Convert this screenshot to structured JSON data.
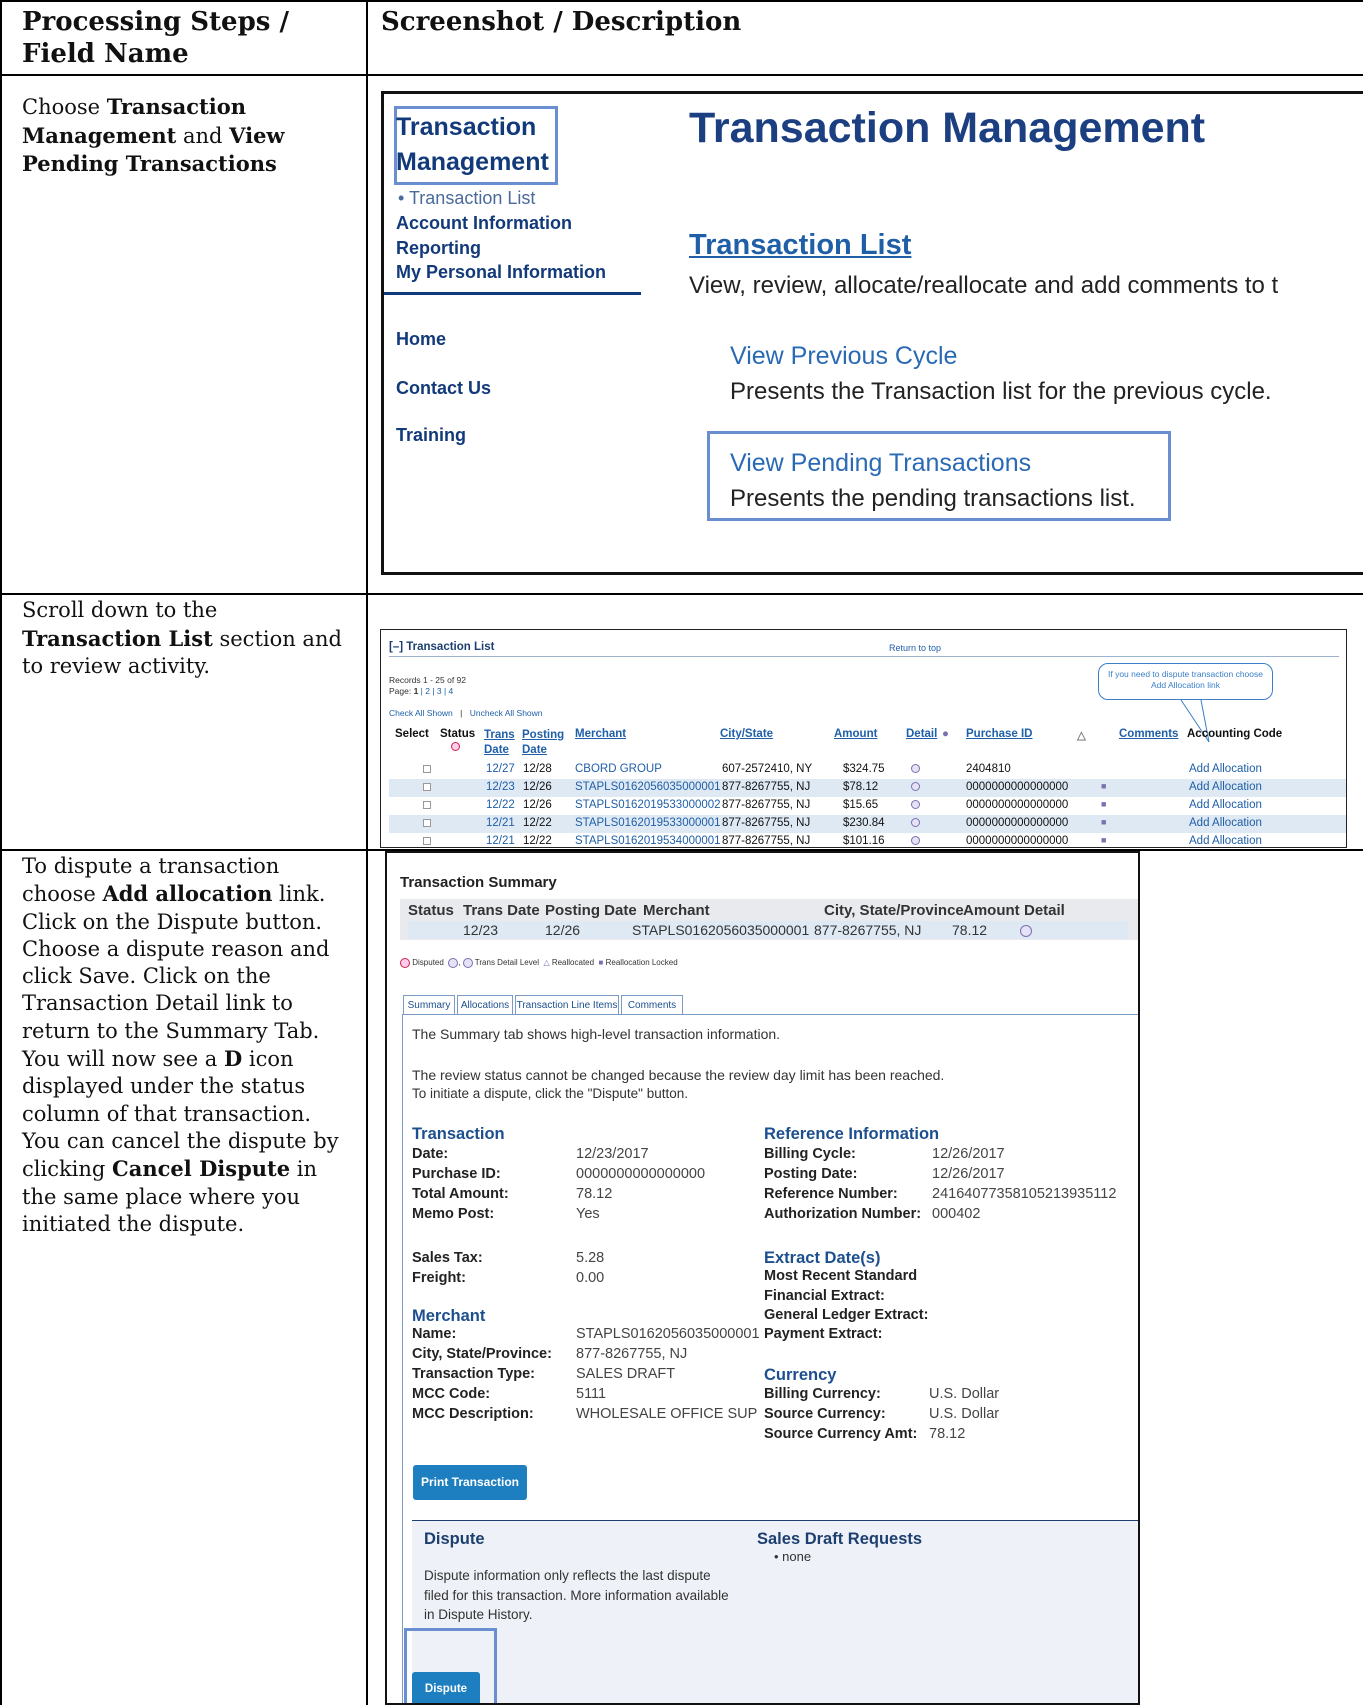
{
  "headers": {
    "col1": "Processing Steps / Field Name",
    "col2": "Screenshot / Description"
  },
  "steps": {
    "s1_a": "Choose ",
    "s1_b": "Transaction Management",
    "s1_c": " and ",
    "s1_d": "View Pending Transactions",
    "s2_a": "Scroll down to the ",
    "s2_b": "Transaction List",
    "s2_c": " section and to review activity.",
    "s3_a": "To dispute a transaction choose ",
    "s3_b": "Add allocation",
    "s3_c": " link. Click on the Dispute button. Choose a dispute reason and click Save. Click on the Transaction Detail link to return to the Summary Tab. You will now see a ",
    "s3_d": "D",
    "s3_e": " icon displayed under the status column of that transaction. You can cancel the dispute by clicking ",
    "s3_f": "Cancel Dispute",
    "s3_g": " in the same place where you initiated the dispute."
  },
  "shot1": {
    "nav_tm_1": "Transaction",
    "nav_tm_2": "Management",
    "nav_sub": "• Transaction List",
    "nav_account": "Account Information",
    "nav_reporting": "Reporting",
    "nav_personal": "My Personal Information",
    "nav_home": "Home",
    "nav_contact": "Contact Us",
    "nav_training": "Training",
    "title": "Transaction Management",
    "list_link": "Transaction List",
    "list_desc": "View, review, allocate/reallocate and add comments to t",
    "prev_link": "View Previous Cycle",
    "prev_desc": "Presents the Transaction list for the previous cycle.",
    "pending_link": "View Pending Transactions",
    "pending_desc": "Presents the pending transactions list."
  },
  "shot2": {
    "section_title": "[–] Transaction List",
    "return_top": "Return to top",
    "records": "Records 1 - 25 of 92",
    "page_label": "Page: ",
    "page_current": "1",
    "page_others": " | 2 | 3 | 4",
    "check_all": "Check All Shown",
    "sep": "|",
    "uncheck_all": "Uncheck All Shown",
    "callout": "If you need to dispute transaction choose Add Allocation link",
    "columns": {
      "select": "Select",
      "status": "Status",
      "trans_date_1": "Trans",
      "trans_date_2": "Date",
      "posting_date_1": "Posting",
      "posting_date_2": "Date",
      "merchant": "Merchant",
      "city_state": "City/State",
      "amount": "Amount",
      "detail": "Detail",
      "purchase_id": "Purchase ID",
      "comments": "Comments",
      "accounting_code": "Accounting Code"
    },
    "rows": [
      {
        "trans": "12/27",
        "post": "12/28",
        "merchant": "CBORD GROUP",
        "city": "607-2572410, NY",
        "amount": "$324.75",
        "pid": "2404810",
        "action": "Add Allocation"
      },
      {
        "trans": "12/23",
        "post": "12/26",
        "merchant": "STAPLS0162056035000001",
        "city": "877-8267755, NJ",
        "amount": "$78.12",
        "pid": "0000000000000000",
        "action": "Add Allocation"
      },
      {
        "trans": "12/22",
        "post": "12/26",
        "merchant": "STAPLS0162019533000002",
        "city": "877-8267755, NJ",
        "amount": "$15.65",
        "pid": "0000000000000000",
        "action": "Add Allocation"
      },
      {
        "trans": "12/21",
        "post": "12/22",
        "merchant": "STAPLS0162019533000001",
        "city": "877-8267755, NJ",
        "amount": "$230.84",
        "pid": "0000000000000000",
        "action": "Add Allocation"
      },
      {
        "trans": "12/21",
        "post": "12/22",
        "merchant": "STAPLS0162019534000001",
        "city": "877-8267755, NJ",
        "amount": "$101.16",
        "pid": "0000000000000000",
        "action": "Add Allocation"
      }
    ]
  },
  "shot3": {
    "summary_title": "Transaction Summary",
    "cols": {
      "status": "Status",
      "trans_date": "Trans Date",
      "posting_date": "Posting Date",
      "merchant": "Merchant",
      "city": "City, State/Province",
      "amount": "Amount",
      "detail": "Detail"
    },
    "row": {
      "trans_date": "12/23",
      "posting_date": "12/26",
      "merchant": "STAPLS0162056035000001",
      "city": "877-8267755, NJ",
      "amount": "78.12"
    },
    "legend": {
      "disputed": "Disputed",
      "trans_detail": "Trans Detail Level",
      "reallocated": "Reallocated",
      "locked": "Reallocation Locked"
    },
    "tabs": [
      "Summary",
      "Allocations",
      "Transaction Line Items",
      "Comments"
    ],
    "intro": "The Summary tab shows high-level transaction information.",
    "note1": "The review status cannot be changed because the review day limit has been reached.",
    "note2": "To initiate a dispute, click the \"Dispute\" button.",
    "transaction": {
      "heading": "Transaction",
      "date_l": "Date:",
      "date_v": "12/23/2017",
      "pid_l": "Purchase ID:",
      "pid_v": "0000000000000000",
      "total_l": "Total Amount:",
      "total_v": "78.12",
      "memo_l": "Memo Post:",
      "memo_v": "Yes",
      "tax_l": "Sales Tax:",
      "tax_v": "5.28",
      "freight_l": "Freight:",
      "freight_v": "0.00"
    },
    "reference": {
      "heading": "Reference Information",
      "cycle_l": "Billing Cycle:",
      "cycle_v": "12/26/2017",
      "post_l": "Posting Date:",
      "post_v": "12/26/2017",
      "ref_l": "Reference Number:",
      "ref_v": "24164077358105213935112",
      "auth_l": "Authorization Number:",
      "auth_v": "000402"
    },
    "extract": {
      "heading": "Extract Date(s)",
      "l1": "Most Recent Standard",
      "l2": "Financial Extract:",
      "l3": "General Ledger Extract:",
      "l4": "Payment Extract:"
    },
    "merchant": {
      "heading": "Merchant",
      "name_l": "Name:",
      "name_v": "STAPLS0162056035000001",
      "city_l": "City, State/Province:",
      "city_v": "877-8267755, NJ",
      "type_l": "Transaction Type:",
      "type_v": "SALES DRAFT",
      "mcc_l": "MCC Code:",
      "mcc_v": "5111",
      "mccd_l": "MCC Description:",
      "mccd_v": "WHOLESALE OFFICE SUP"
    },
    "currency": {
      "heading": "Currency",
      "bill_l": "Billing Currency:",
      "bill_v": "U.S. Dollar",
      "src_l": "Source Currency:",
      "src_v": "U.S. Dollar",
      "amt_l": "Source Currency Amt:",
      "amt_v": "78.12"
    },
    "print_button": "Print Transaction",
    "dispute": {
      "heading": "Dispute",
      "text1": "Dispute information only reflects the last dispute",
      "text2": "filed for this transaction. More information available",
      "text3": "in Dispute History.",
      "button": "Dispute"
    },
    "sales_draft": {
      "heading": "Sales Draft Requests",
      "item": "• none"
    }
  },
  "colors": {
    "nav_blue": "#123a7a",
    "link_blue": "#1f5fa8",
    "highlight": "#6a8fd0",
    "button_blue": "#1d7fc0",
    "row_shade": "#dfe9f4"
  }
}
